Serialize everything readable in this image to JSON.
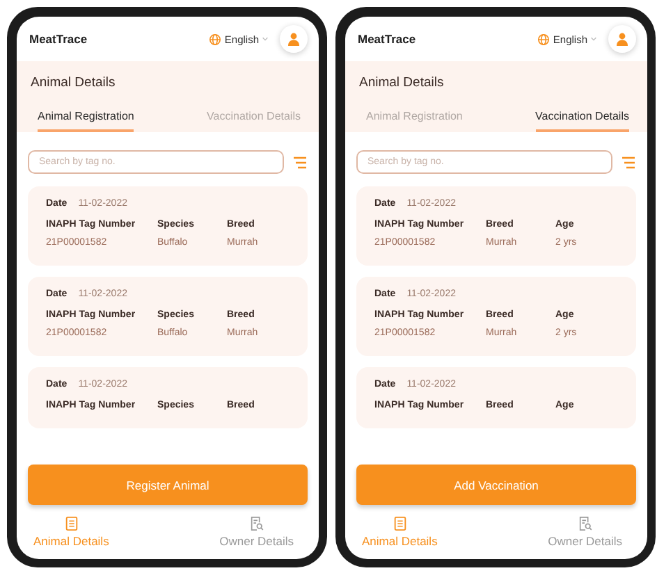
{
  "phones": [
    {
      "app_name": "MeatTrace",
      "language": "English",
      "page_title": "Animal Details",
      "tabs": [
        {
          "label": "Animal Registration",
          "selected": true
        },
        {
          "label": "Vaccination Details",
          "selected": false
        }
      ],
      "search": {
        "placeholder": "Search by tag no."
      },
      "records": [
        {
          "date_label": "Date",
          "date": "11-02-2022",
          "fields": [
            {
              "label": "INAPH Tag Number",
              "value": "21P00001582"
            },
            {
              "label": "Species",
              "value": "Buffalo"
            },
            {
              "label": "Breed",
              "value": "Murrah"
            }
          ]
        },
        {
          "date_label": "Date",
          "date": "11-02-2022",
          "fields": [
            {
              "label": "INAPH Tag Number",
              "value": "21P00001582"
            },
            {
              "label": "Species",
              "value": "Buffalo"
            },
            {
              "label": "Breed",
              "value": "Murrah"
            }
          ]
        },
        {
          "date_label": "Date",
          "date": "11-02-2022",
          "fields": [
            {
              "label": "INAPH Tag Number"
            },
            {
              "label": "Species"
            },
            {
              "label": "Breed"
            }
          ]
        }
      ],
      "action": "Register Animal",
      "nav": [
        {
          "label": "Animal Details",
          "kind": "animals",
          "selected": true
        },
        {
          "label": "Owner Details",
          "kind": "owner",
          "selected": false
        }
      ]
    },
    {
      "app_name": "MeatTrace",
      "language": "English",
      "page_title": "Animal Details",
      "tabs": [
        {
          "label": "Animal Registration",
          "selected": false
        },
        {
          "label": "Vaccination Details",
          "selected": true
        }
      ],
      "search": {
        "placeholder": "Search by tag no."
      },
      "records": [
        {
          "date_label": "Date",
          "date": "11-02-2022",
          "fields": [
            {
              "label": "INAPH Tag Number",
              "value": "21P00001582"
            },
            {
              "label": "Breed",
              "value": "Murrah"
            },
            {
              "label": "Age",
              "value": "2 yrs"
            }
          ]
        },
        {
          "date_label": "Date",
          "date": "11-02-2022",
          "fields": [
            {
              "label": "INAPH Tag Number",
              "value": "21P00001582"
            },
            {
              "label": "Breed",
              "value": "Murrah"
            },
            {
              "label": "Age",
              "value": "2 yrs"
            }
          ]
        },
        {
          "date_label": "Date",
          "date": "11-02-2022",
          "fields": [
            {
              "label": "INAPH Tag Number"
            },
            {
              "label": "Breed"
            },
            {
              "label": "Age"
            }
          ]
        }
      ],
      "action": "Add Vaccination",
      "nav": [
        {
          "label": "Animal Details",
          "kind": "animals",
          "selected": true
        },
        {
          "label": "Owner Details",
          "kind": "owner",
          "selected": false
        }
      ]
    }
  ]
}
